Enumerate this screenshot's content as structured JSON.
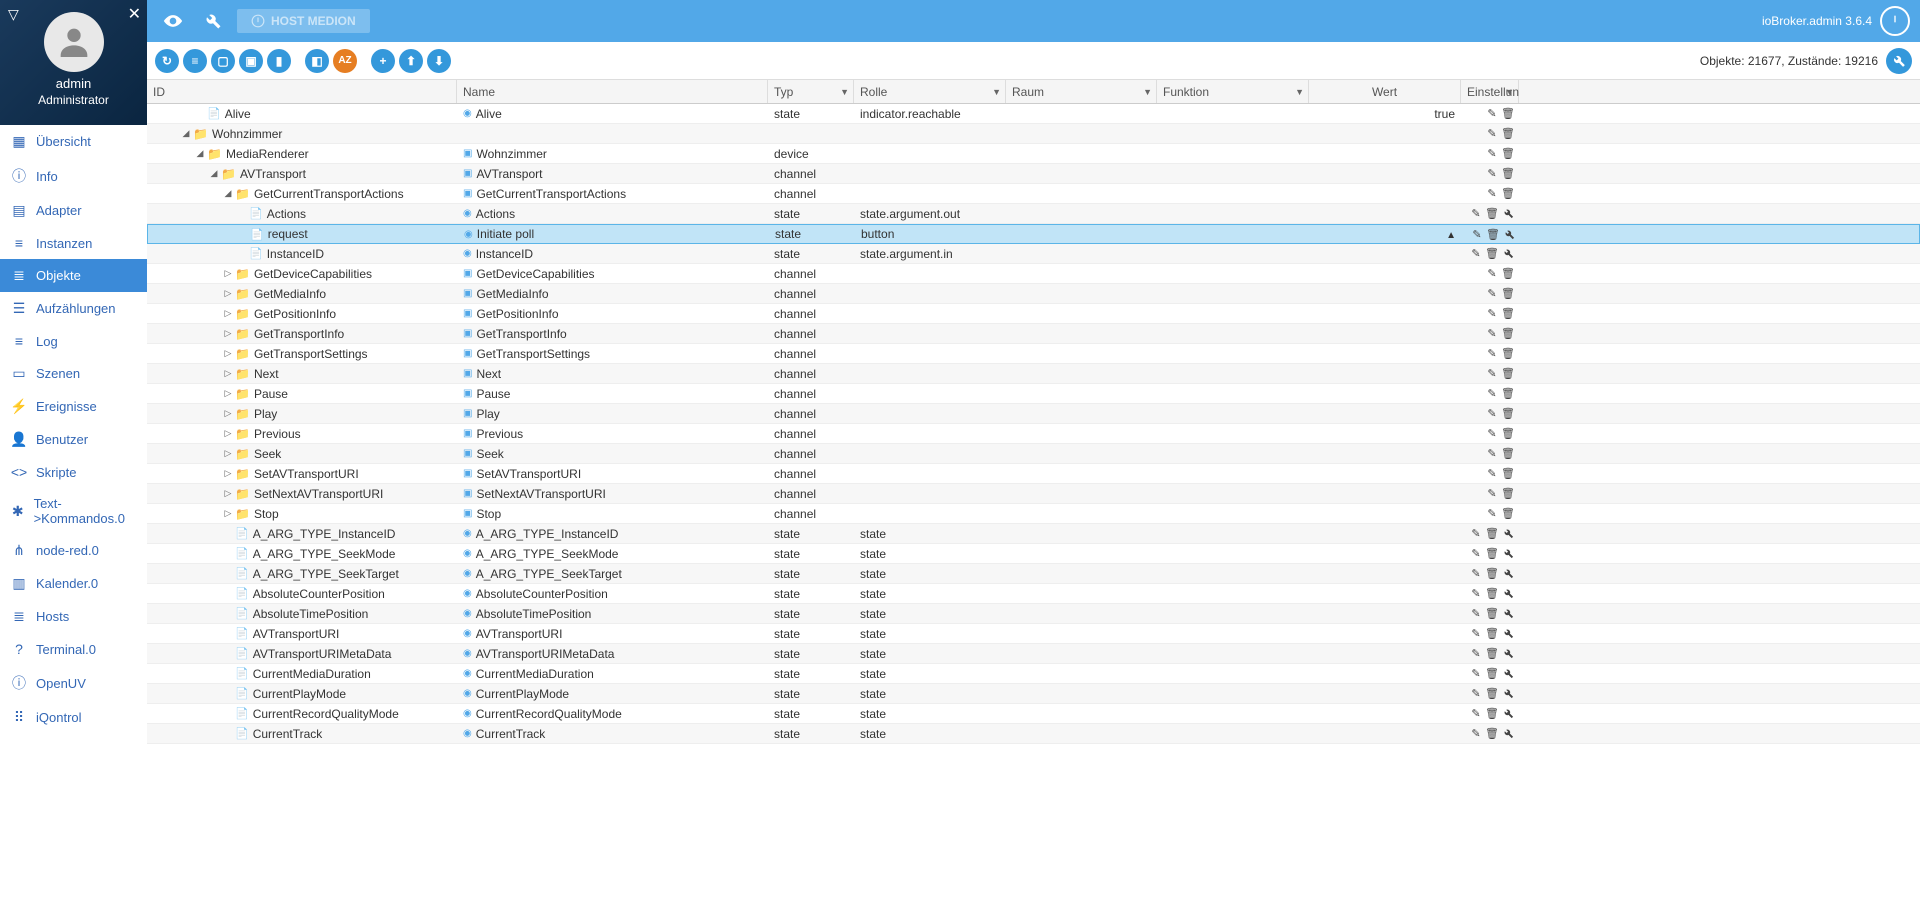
{
  "user": {
    "name": "admin",
    "role": "Administrator"
  },
  "nav": [
    {
      "icon": "grid",
      "label": "Übersicht"
    },
    {
      "icon": "info",
      "label": "Info"
    },
    {
      "icon": "adapter",
      "label": "Adapter"
    },
    {
      "icon": "instance",
      "label": "Instanzen"
    },
    {
      "icon": "objects",
      "label": "Objekte",
      "active": true
    },
    {
      "icon": "list",
      "label": "Aufzählungen"
    },
    {
      "icon": "log",
      "label": "Log"
    },
    {
      "icon": "scene",
      "label": "Szenen"
    },
    {
      "icon": "event",
      "label": "Ereignisse"
    },
    {
      "icon": "user",
      "label": "Benutzer"
    },
    {
      "icon": "script",
      "label": "Skripte"
    },
    {
      "icon": "cmd",
      "label": "Text->Kommandos.0"
    },
    {
      "icon": "nodered",
      "label": "node-red.0"
    },
    {
      "icon": "calendar",
      "label": "Kalender.0"
    },
    {
      "icon": "hosts",
      "label": "Hosts"
    },
    {
      "icon": "terminal",
      "label": "Terminal.0"
    },
    {
      "icon": "openuv",
      "label": "OpenUV"
    },
    {
      "icon": "iqontrol",
      "label": "iQontrol"
    }
  ],
  "topbar": {
    "host": "HOST MEDION",
    "version": "ioBroker.admin 3.6.4"
  },
  "counts": "Objekte: 21677, Zustände: 19216",
  "headers": {
    "id": "ID",
    "name": "Name",
    "typ": "Typ",
    "rolle": "Rolle",
    "raum": "Raum",
    "funktion": "Funktion",
    "wert": "Wert",
    "settings": "Einstellun"
  },
  "rows": [
    {
      "indent": 2,
      "kind": "file",
      "id": "Alive",
      "nicon": "dot",
      "name": "Alive",
      "typ": "state",
      "rolle": "indicator.reachable",
      "wert": "true"
    },
    {
      "indent": 1,
      "kind": "folder",
      "toggle": "open",
      "id": "Wohnzimmer"
    },
    {
      "indent": 2,
      "kind": "folder",
      "toggle": "open",
      "id": "MediaRenderer",
      "nicon": "sq",
      "name": "Wohnzimmer",
      "typ": "device"
    },
    {
      "indent": 3,
      "kind": "folder",
      "toggle": "open",
      "id": "AVTransport",
      "nicon": "sq",
      "name": "AVTransport",
      "typ": "channel"
    },
    {
      "indent": 4,
      "kind": "folder",
      "toggle": "open",
      "id": "GetCurrentTransportActions",
      "nicon": "sq",
      "name": "GetCurrentTransportActions",
      "typ": "channel"
    },
    {
      "indent": 5,
      "kind": "file",
      "id": "Actions",
      "nicon": "dot",
      "name": "Actions",
      "typ": "state",
      "rolle": "state.argument.out",
      "wrench": true
    },
    {
      "indent": 5,
      "kind": "file",
      "id": "request",
      "nicon": "dot",
      "name": "Initiate poll",
      "typ": "state",
      "rolle": "button",
      "wert_btn": true,
      "selected": true,
      "wrench": true
    },
    {
      "indent": 5,
      "kind": "file",
      "id": "InstanceID",
      "nicon": "dot",
      "name": "InstanceID",
      "typ": "state",
      "rolle": "state.argument.in",
      "wrench": true
    },
    {
      "indent": 4,
      "kind": "folder",
      "toggle": "closed",
      "id": "GetDeviceCapabilities",
      "nicon": "sq",
      "name": "GetDeviceCapabilities",
      "typ": "channel"
    },
    {
      "indent": 4,
      "kind": "folder",
      "toggle": "closed",
      "id": "GetMediaInfo",
      "nicon": "sq",
      "name": "GetMediaInfo",
      "typ": "channel"
    },
    {
      "indent": 4,
      "kind": "folder",
      "toggle": "closed",
      "id": "GetPositionInfo",
      "nicon": "sq",
      "name": "GetPositionInfo",
      "typ": "channel"
    },
    {
      "indent": 4,
      "kind": "folder",
      "toggle": "closed",
      "id": "GetTransportInfo",
      "nicon": "sq",
      "name": "GetTransportInfo",
      "typ": "channel"
    },
    {
      "indent": 4,
      "kind": "folder",
      "toggle": "closed",
      "id": "GetTransportSettings",
      "nicon": "sq",
      "name": "GetTransportSettings",
      "typ": "channel"
    },
    {
      "indent": 4,
      "kind": "folder",
      "toggle": "closed",
      "id": "Next",
      "nicon": "sq",
      "name": "Next",
      "typ": "channel"
    },
    {
      "indent": 4,
      "kind": "folder",
      "toggle": "closed",
      "id": "Pause",
      "nicon": "sq",
      "name": "Pause",
      "typ": "channel"
    },
    {
      "indent": 4,
      "kind": "folder",
      "toggle": "closed",
      "id": "Play",
      "nicon": "sq",
      "name": "Play",
      "typ": "channel"
    },
    {
      "indent": 4,
      "kind": "folder",
      "toggle": "closed",
      "id": "Previous",
      "nicon": "sq",
      "name": "Previous",
      "typ": "channel"
    },
    {
      "indent": 4,
      "kind": "folder",
      "toggle": "closed",
      "id": "Seek",
      "nicon": "sq",
      "name": "Seek",
      "typ": "channel"
    },
    {
      "indent": 4,
      "kind": "folder",
      "toggle": "closed",
      "id": "SetAVTransportURI",
      "nicon": "sq",
      "name": "SetAVTransportURI",
      "typ": "channel"
    },
    {
      "indent": 4,
      "kind": "folder",
      "toggle": "closed",
      "id": "SetNextAVTransportURI",
      "nicon": "sq",
      "name": "SetNextAVTransportURI",
      "typ": "channel"
    },
    {
      "indent": 4,
      "kind": "folder",
      "toggle": "closed",
      "id": "Stop",
      "nicon": "sq",
      "name": "Stop",
      "typ": "channel"
    },
    {
      "indent": 4,
      "kind": "file",
      "id": "A_ARG_TYPE_InstanceID",
      "nicon": "dot",
      "name": "A_ARG_TYPE_InstanceID",
      "typ": "state",
      "rolle": "state",
      "wrench": true
    },
    {
      "indent": 4,
      "kind": "file",
      "id": "A_ARG_TYPE_SeekMode",
      "nicon": "dot",
      "name": "A_ARG_TYPE_SeekMode",
      "typ": "state",
      "rolle": "state",
      "wrench": true
    },
    {
      "indent": 4,
      "kind": "file",
      "id": "A_ARG_TYPE_SeekTarget",
      "nicon": "dot",
      "name": "A_ARG_TYPE_SeekTarget",
      "typ": "state",
      "rolle": "state",
      "wrench": true
    },
    {
      "indent": 4,
      "kind": "file",
      "id": "AbsoluteCounterPosition",
      "nicon": "dot",
      "name": "AbsoluteCounterPosition",
      "typ": "state",
      "rolle": "state",
      "wrench": true
    },
    {
      "indent": 4,
      "kind": "file",
      "id": "AbsoluteTimePosition",
      "nicon": "dot",
      "name": "AbsoluteTimePosition",
      "typ": "state",
      "rolle": "state",
      "wrench": true
    },
    {
      "indent": 4,
      "kind": "file",
      "id": "AVTransportURI",
      "nicon": "dot",
      "name": "AVTransportURI",
      "typ": "state",
      "rolle": "state",
      "wrench": true
    },
    {
      "indent": 4,
      "kind": "file",
      "id": "AVTransportURIMetaData",
      "nicon": "dot",
      "name": "AVTransportURIMetaData",
      "typ": "state",
      "rolle": "state",
      "wrench": true
    },
    {
      "indent": 4,
      "kind": "file",
      "id": "CurrentMediaDuration",
      "nicon": "dot",
      "name": "CurrentMediaDuration",
      "typ": "state",
      "rolle": "state",
      "wrench": true
    },
    {
      "indent": 4,
      "kind": "file",
      "id": "CurrentPlayMode",
      "nicon": "dot",
      "name": "CurrentPlayMode",
      "typ": "state",
      "rolle": "state",
      "wrench": true
    },
    {
      "indent": 4,
      "kind": "file",
      "id": "CurrentRecordQualityMode",
      "nicon": "dot",
      "name": "CurrentRecordQualityMode",
      "typ": "state",
      "rolle": "state",
      "wrench": true
    },
    {
      "indent": 4,
      "kind": "file",
      "id": "CurrentTrack",
      "nicon": "dot",
      "name": "CurrentTrack",
      "typ": "state",
      "rolle": "state",
      "wrench": true
    }
  ]
}
